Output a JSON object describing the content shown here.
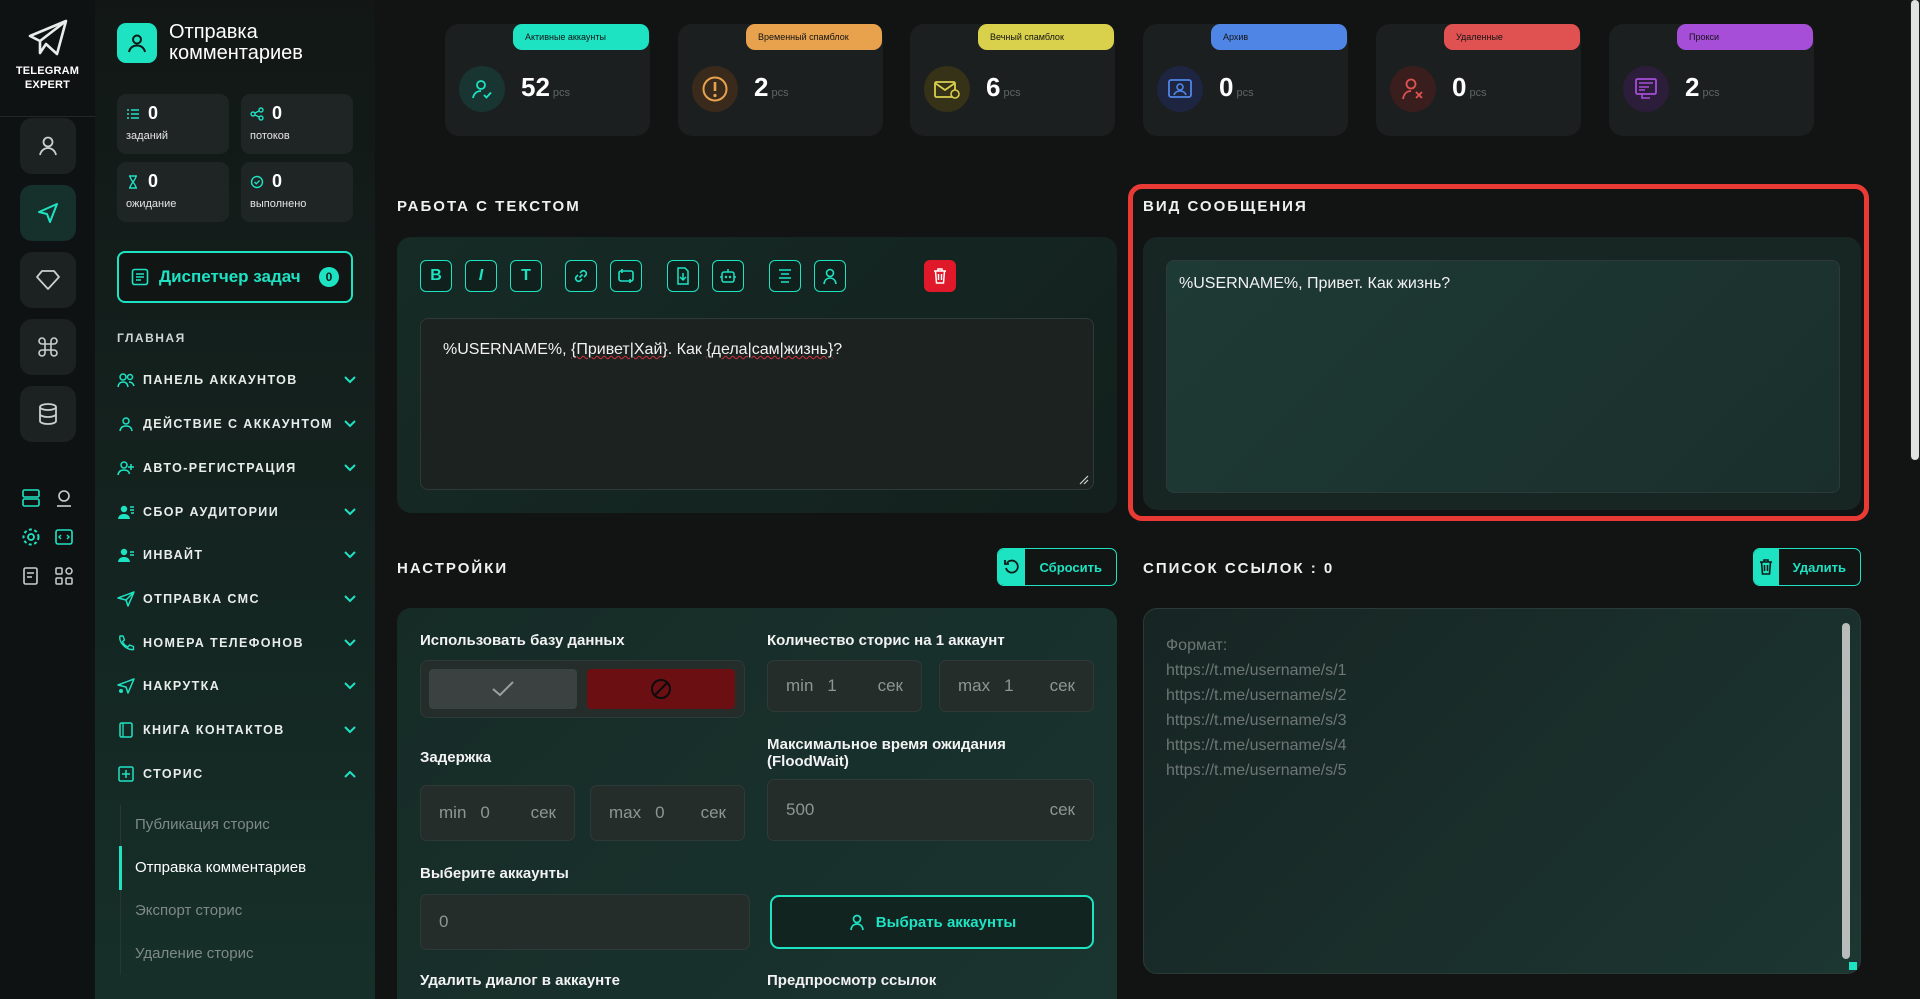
{
  "brand": {
    "line1": "TELEGRAM",
    "line2": "EXPERT"
  },
  "sidebar": {
    "title": "Отправка комментариев",
    "stats": [
      {
        "value": "0",
        "label": "заданий",
        "icon": "list-icon"
      },
      {
        "value": "0",
        "label": "потоков",
        "icon": "share-icon"
      },
      {
        "value": "0",
        "label": "ожидание",
        "icon": "hourglass-icon"
      },
      {
        "value": "0",
        "label": "выполнено",
        "icon": "check-circle-icon"
      }
    ],
    "dispatcher": {
      "label": "Диспетчер задач",
      "badge": "0"
    },
    "section": "ГЛАВНАЯ",
    "nav": [
      {
        "label": "ПАНЕЛЬ АККАУНТОВ",
        "icon": "users-icon"
      },
      {
        "label": "ДЕЙСТВИЕ С АККАУНТОМ",
        "icon": "user-icon"
      },
      {
        "label": "АВТО-РЕГИСТРАЦИЯ",
        "icon": "user-plus-icon"
      },
      {
        "label": "СБОР АУДИТОРИИ",
        "icon": "audience-icon"
      },
      {
        "label": "ИНВАЙТ",
        "icon": "invite-icon"
      },
      {
        "label": "ОТПРАВКА СМС",
        "icon": "send-icon"
      },
      {
        "label": "НОМЕРА ТЕЛЕФОНОВ",
        "icon": "phone-icon"
      },
      {
        "label": "НАКРУТКА",
        "icon": "boost-icon"
      },
      {
        "label": "КНИГА КОНТАКТОВ",
        "icon": "book-icon"
      },
      {
        "label": "СТОРИС",
        "icon": "plus-square-icon"
      }
    ],
    "sub": [
      {
        "label": "Публикация сторис"
      },
      {
        "label": "Отправка комментариев"
      },
      {
        "label": "Экспорт сторис"
      },
      {
        "label": "Удаление сторис"
      }
    ]
  },
  "cards": [
    {
      "label": "Активные аккаунты",
      "value": "52",
      "unit": "pcs",
      "color": "#1ee3c3"
    },
    {
      "label": "Временный спамблок",
      "value": "2",
      "unit": "pcs",
      "color": "#e8a24e"
    },
    {
      "label": "Вечный спамблок",
      "value": "6",
      "unit": "pcs",
      "color": "#d9d04c"
    },
    {
      "label": "Архив",
      "value": "0",
      "unit": "pcs",
      "color": "#4f86e6"
    },
    {
      "label": "Удаленные",
      "value": "0",
      "unit": "pcs",
      "color": "#e05252"
    },
    {
      "label": "Прокси",
      "value": "2",
      "unit": "pcs",
      "color": "#a64ed8"
    }
  ],
  "text_section": {
    "title": "РАБОТА С ТЕКСТОМ",
    "toolbar": {
      "bold": "B",
      "italic": "I",
      "text": "T"
    },
    "content_prefix": "%USERNAME%, ",
    "content_spin1": "{Привет|Хай}",
    "content_mid": ". Как ",
    "content_spin2": "{дела|сам|жизнь}",
    "content_suffix": "?"
  },
  "preview": {
    "title": "ВИД СООБЩЕНИЯ",
    "text": "%USERNAME%, Привет. Как жизнь?"
  },
  "settings": {
    "title": "НАСТРОЙКИ",
    "reset_label": "Сбросить",
    "use_db_label": "Использовать базу данных",
    "stories_label": "Количество сторис на 1 аккаунт",
    "stories_min": {
      "prefix": "min",
      "value": "1",
      "suffix": "сек"
    },
    "stories_max": {
      "prefix": "max",
      "value": "1",
      "suffix": "сек"
    },
    "delay_label": "Задержка",
    "delay_min": {
      "prefix": "min",
      "value": "0",
      "suffix": "сек"
    },
    "delay_max": {
      "prefix": "max",
      "value": "0",
      "suffix": "сек"
    },
    "floodwait_label_1": "Максимальное время ожидания",
    "floodwait_label_2": "(FloodWait)",
    "floodwait_value": "500",
    "floodwait_suffix": "сек",
    "accounts_label": "Выберите аккаунты",
    "accounts_value": "0",
    "select_accounts_label": "Выбрать аккаунты",
    "delete_dialog_label": "Удалить диалог в аккаунте",
    "link_preview_label": "Предпросмотр ссылок"
  },
  "links": {
    "title": "СПИСОК ССЫЛОК : 0",
    "delete_label": "Удалить",
    "placeholder_lines": [
      "Формат:",
      "https://t.me/username/s/1",
      "https://t.me/username/s/2",
      "https://t.me/username/s/3",
      "https://t.me/username/s/4",
      "https://t.me/username/s/5"
    ]
  },
  "colors": {
    "accent": "#1ee3c3",
    "danger": "#e0192a",
    "highlight": "#ea3a36"
  }
}
